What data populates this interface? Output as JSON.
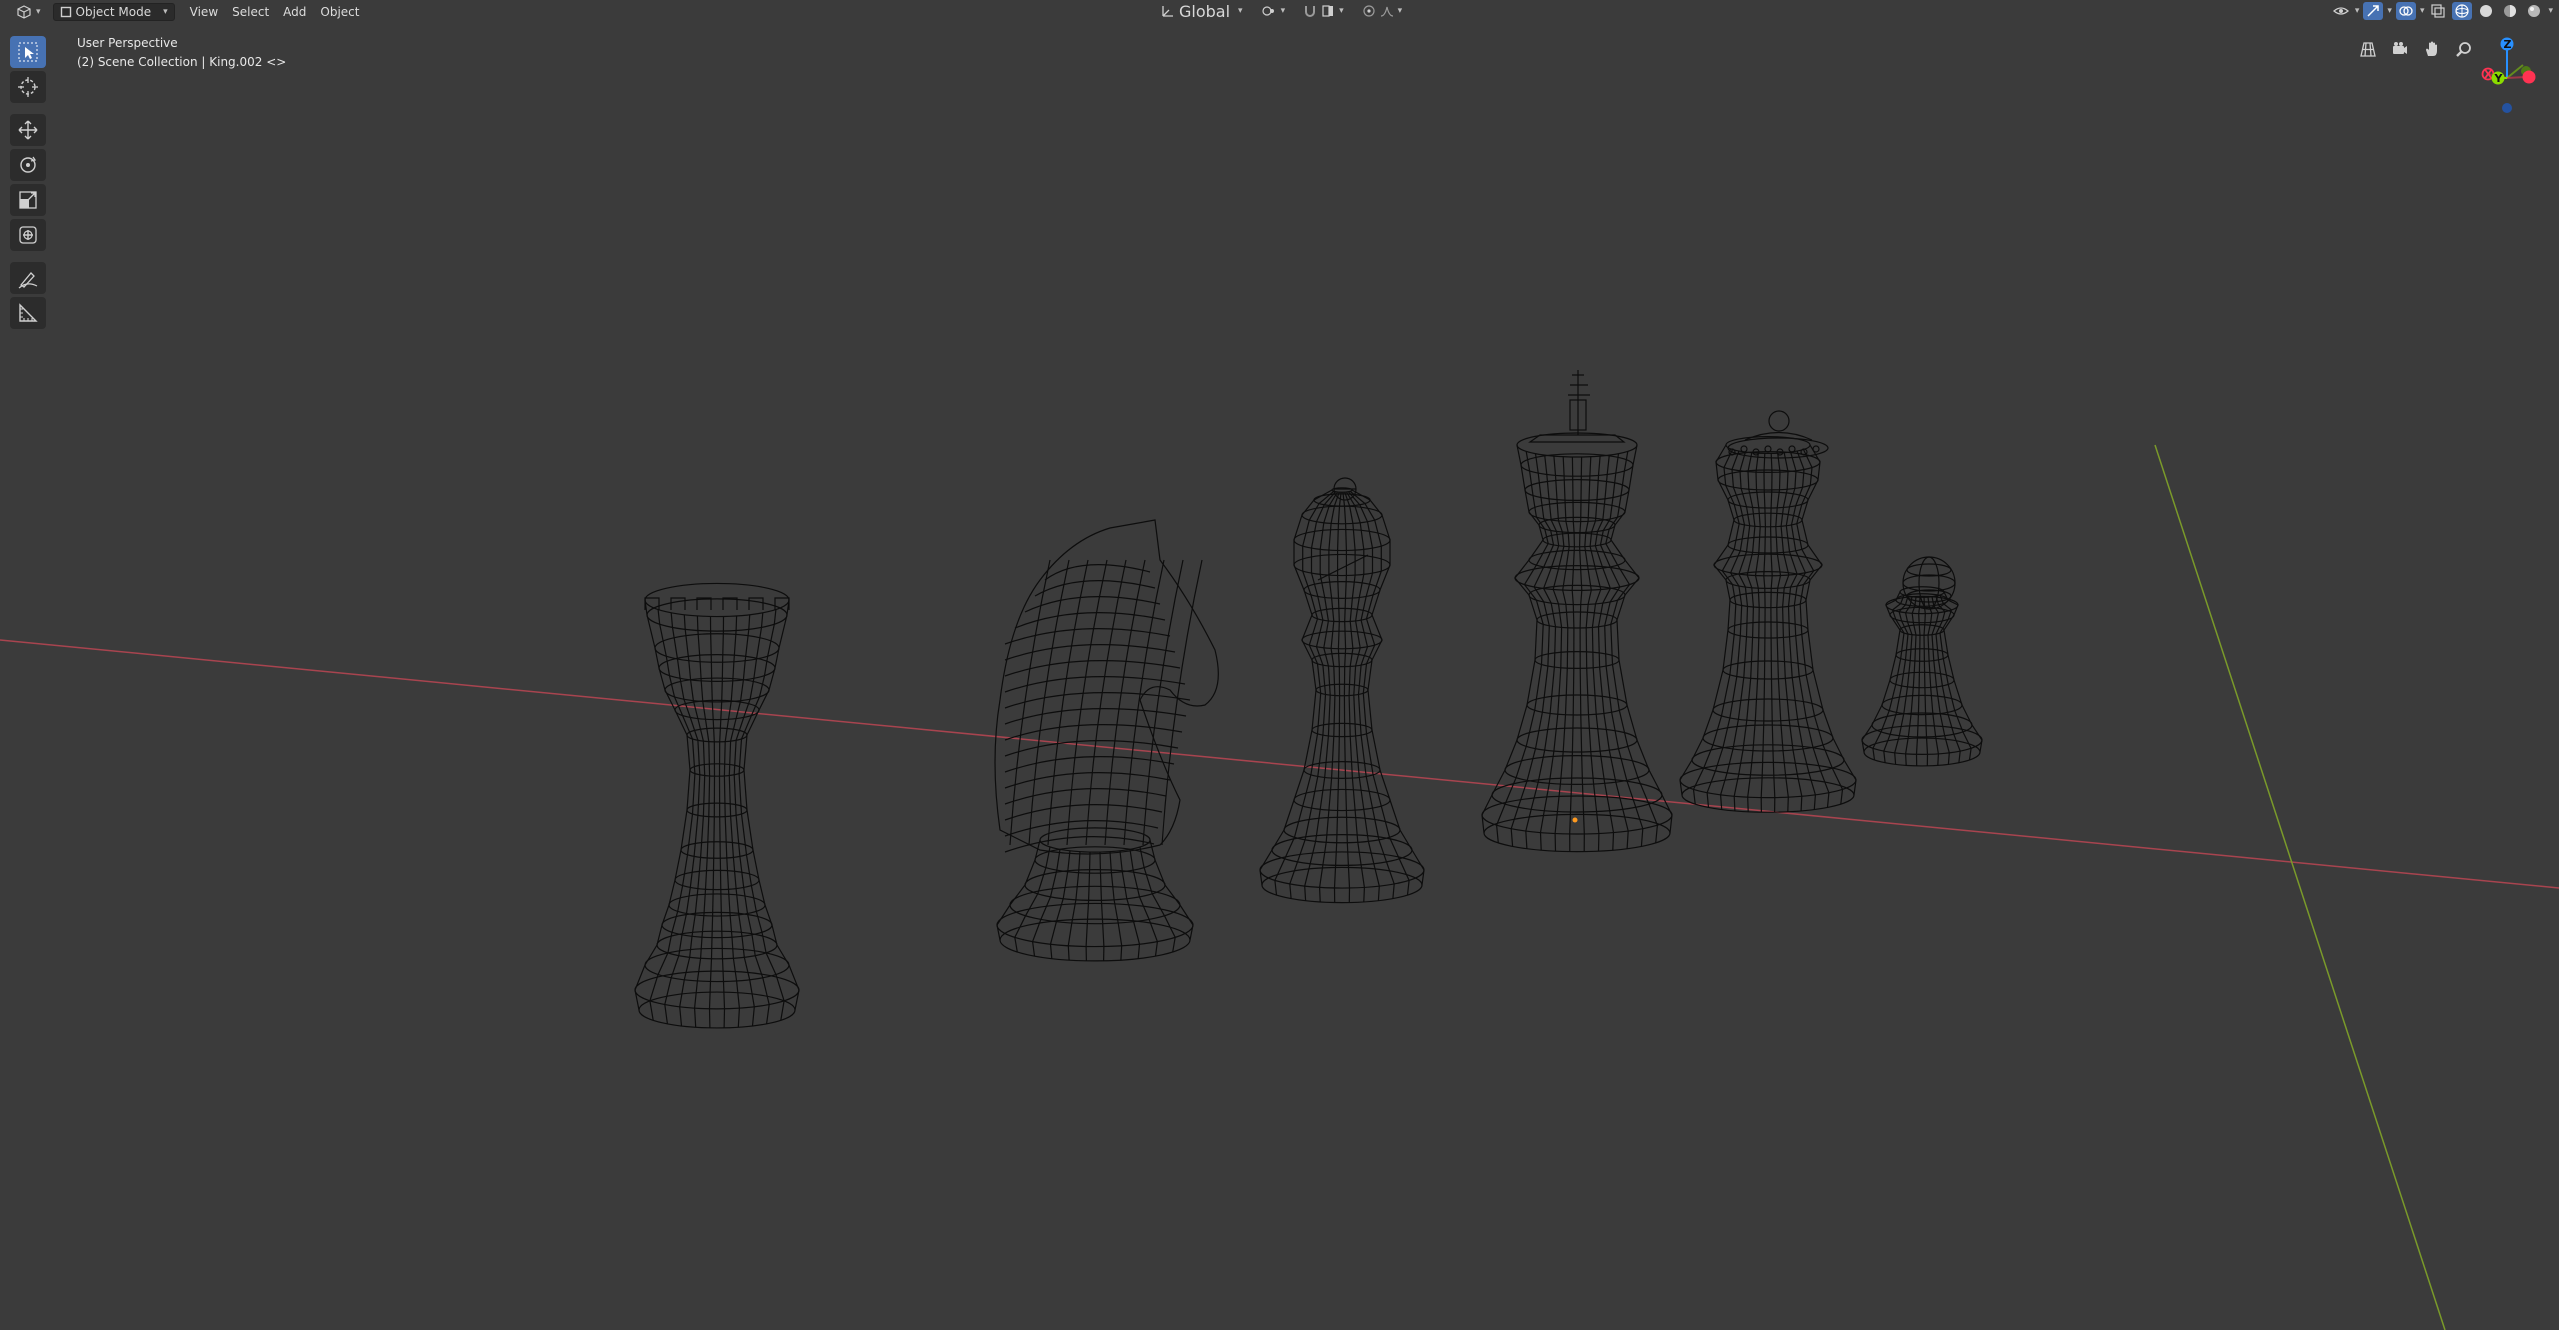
{
  "header": {
    "editor_type_icon": "3d-viewport-icon",
    "mode": "Object Mode",
    "menus": [
      "View",
      "Select",
      "Add",
      "Object"
    ],
    "transform_orientation": "Global"
  },
  "overlay": {
    "view_name": "User Perspective",
    "collection_info": "(2) Scene Collection | King.002 <>"
  },
  "toolbar": {
    "tools": [
      {
        "name": "select-box-icon",
        "active": true
      },
      {
        "name": "cursor-icon",
        "active": false
      },
      {
        "name": "move-icon",
        "active": false
      },
      {
        "name": "rotate-icon",
        "active": false
      },
      {
        "name": "scale-icon",
        "active": false
      },
      {
        "name": "transform-icon",
        "active": false
      },
      {
        "name": "annotate-icon",
        "active": false
      },
      {
        "name": "measure-icon",
        "active": false
      }
    ]
  },
  "navigation": {
    "buttons": [
      "grid-view-icon",
      "camera-icon",
      "hand-pan-icon",
      "zoom-icon"
    ]
  },
  "gizmo": {
    "axes": {
      "x": "X",
      "y": "Y",
      "z": "Z"
    },
    "colors": {
      "x": "#ff3352",
      "y": "#8bdc00",
      "z": "#2890ff"
    }
  },
  "scene": {
    "pieces": [
      "rook",
      "knight",
      "bishop",
      "king",
      "queen",
      "pawn"
    ],
    "wire_color": "#0d0d0d",
    "x_axis_color": "#a8444f",
    "y_axis_color": "#7a9a2a"
  }
}
